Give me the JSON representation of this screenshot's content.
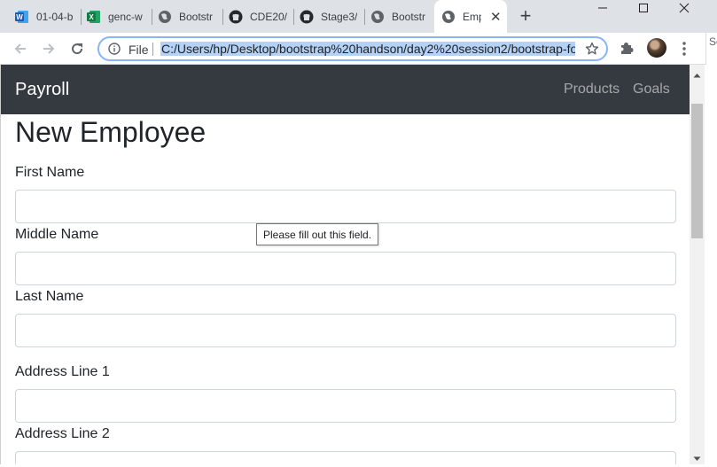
{
  "browser": {
    "tabs": [
      {
        "label": "01-04-b",
        "icon": "word-icon"
      },
      {
        "label": "genc-w",
        "icon": "excel-icon"
      },
      {
        "label": "Bootstr",
        "icon": "globe-icon"
      },
      {
        "label": "CDE20/",
        "icon": "github-icon"
      },
      {
        "label": "Stage3/",
        "icon": "github-icon"
      },
      {
        "label": "Bootstr",
        "icon": "globe-icon"
      },
      {
        "label": "Emp",
        "icon": "globe-icon",
        "active": true
      }
    ],
    "new_tab_label": "+",
    "close_tab_label": "✕",
    "address_bar": {
      "scheme_label": "File",
      "url": "C:/Users/hp/Desktop/bootstrap%20handson/day2%20session2/bootstrap-fo"
    },
    "side_panel_text": "Se"
  },
  "page": {
    "navbar": {
      "brand": "Payroll",
      "links": [
        "Products",
        "Goals"
      ]
    },
    "title": "New Employee",
    "fields": [
      {
        "label": "First Name",
        "value": ""
      },
      {
        "label": "Middle Name",
        "value": ""
      },
      {
        "label": "Last Name",
        "value": ""
      },
      {
        "label": "Address Line 1",
        "value": ""
      },
      {
        "label": "Address Line 2",
        "value": ""
      }
    ],
    "validation_tooltip": "Please fill out this field."
  },
  "colors": {
    "navbar_bg": "#343a40",
    "tabstrip_bg": "#dee1e6",
    "url_highlight": "#b4d2f6",
    "focus_ring": "#8ab4f8"
  }
}
